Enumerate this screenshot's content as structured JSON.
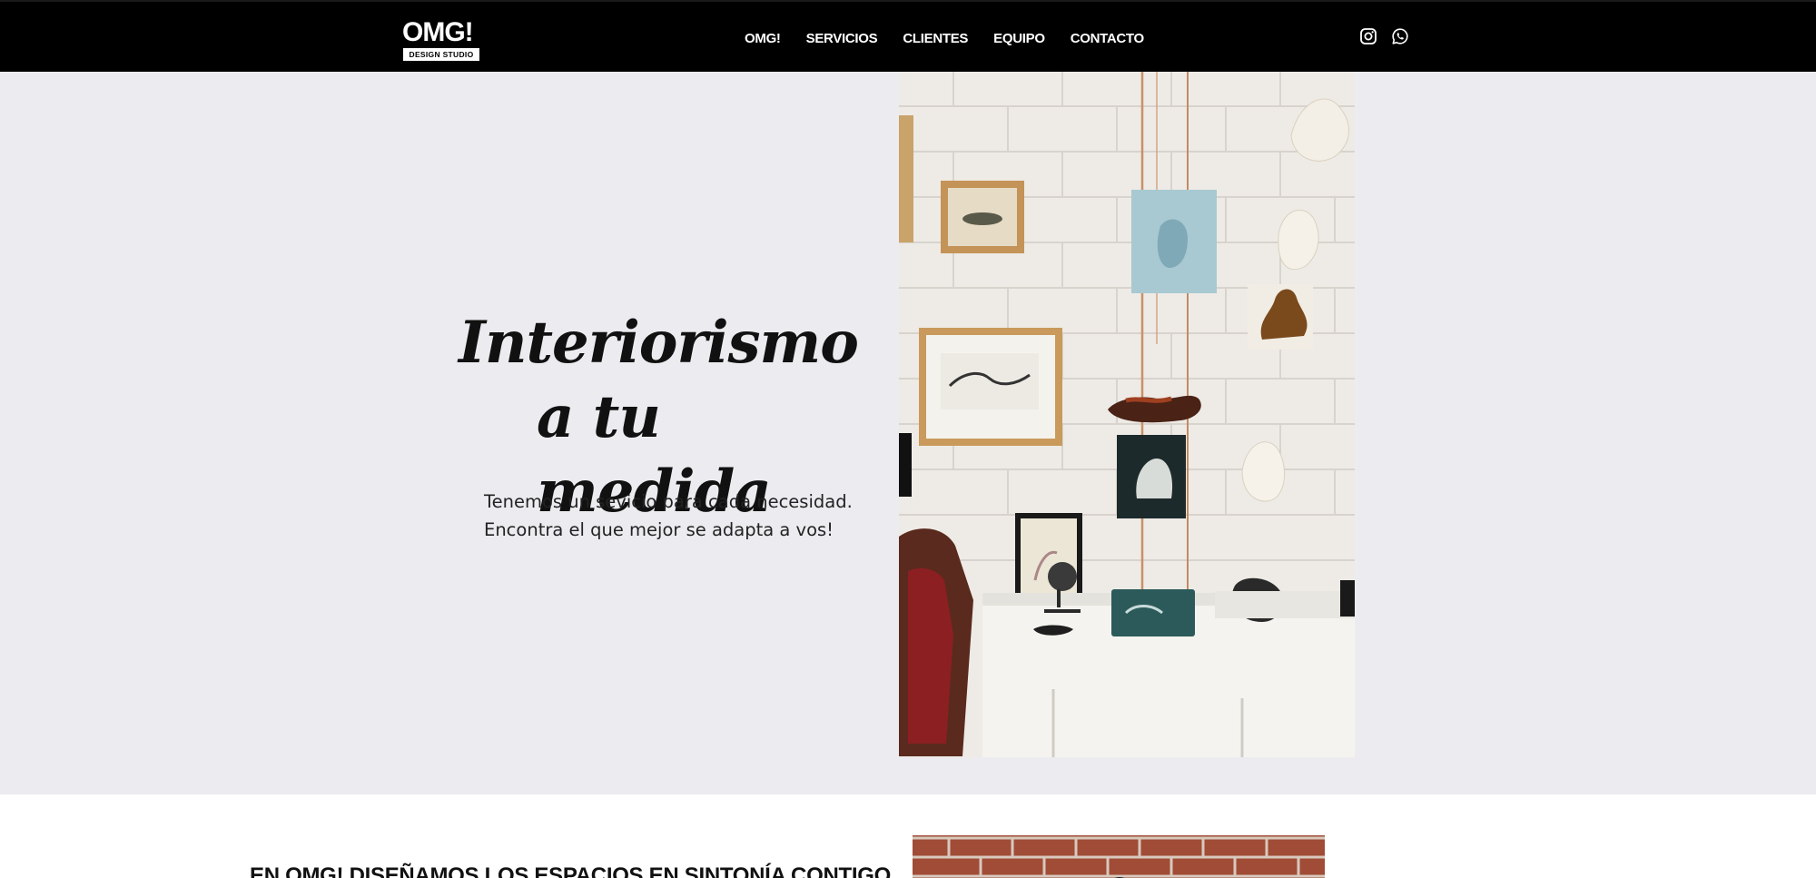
{
  "brand": {
    "name": "OMG!",
    "tagline": "DESIGN STUDIO"
  },
  "nav": {
    "items": [
      {
        "label": "OMG!"
      },
      {
        "label": "SERVICIOS"
      },
      {
        "label": "CLIENTES"
      },
      {
        "label": "EQUIPO"
      },
      {
        "label": "CONTACTO"
      }
    ],
    "social": [
      {
        "icon": "instagram-icon"
      },
      {
        "icon": "whatsapp-icon"
      }
    ]
  },
  "hero": {
    "title_line1": "Interiorismo",
    "title_line2": "a tu medida",
    "text_line1": "Tenemos un sevicio para cada necesidad.",
    "text_line2": "Encontra el que mejor se adapta a vos!"
  },
  "about": {
    "heading": "EN OMG! DISEÑAMOS LOS ESPACIOS EN SINTONÍA CONTIGO"
  },
  "colors": {
    "nav_background": "#000000",
    "hero_background": "#ececf0",
    "text": "#111111"
  }
}
